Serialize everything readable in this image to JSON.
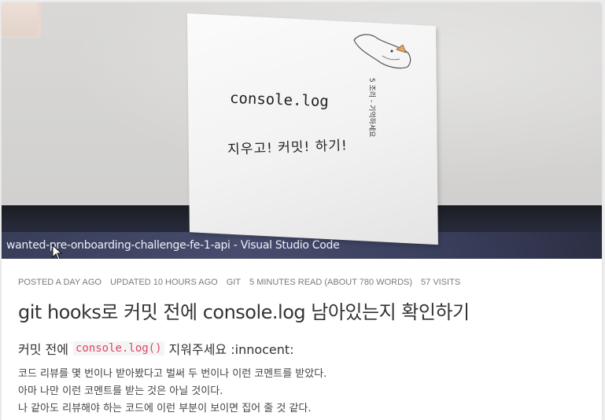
{
  "hero": {
    "monitor_title": "wanted-pre-onboarding-challenge-fe-1-api - Visual Studio Code",
    "note_line_1": "console.log",
    "note_line_2": "지우고! 커밋! 하기!",
    "note_side": "5 조리 - 기억하세요"
  },
  "post": {
    "meta": {
      "posted": "POSTED A DAY AGO",
      "updated": "UPDATED 10 HOURS AGO",
      "category": "GIT",
      "read_time": "5 MINUTES READ (ABOUT 780 WORDS)",
      "visits": "57 VISITS"
    },
    "title": "git hooks로 커밋 전에 console.log 남아있는지 확인하기",
    "subtitle_prefix": "커밋 전에",
    "subtitle_code": "console.log()",
    "subtitle_suffix": "지워주세요 :innocent:",
    "body_lines": [
      "코드 리뷰를 몇 번이나 받아봤다고 벌써 두 번이나 이런 코멘트를 받았다.",
      "아마 나만 이런 코멘트를 받는 것은 아닐 것이다.",
      "나 같아도 리뷰해야 하는 코드에 이런 부분이 보이면 집어 줄 것 같다."
    ]
  },
  "colors": {
    "code_text": "#e0455f",
    "meta_text": "#7a7a7a",
    "title_text": "#333333"
  }
}
